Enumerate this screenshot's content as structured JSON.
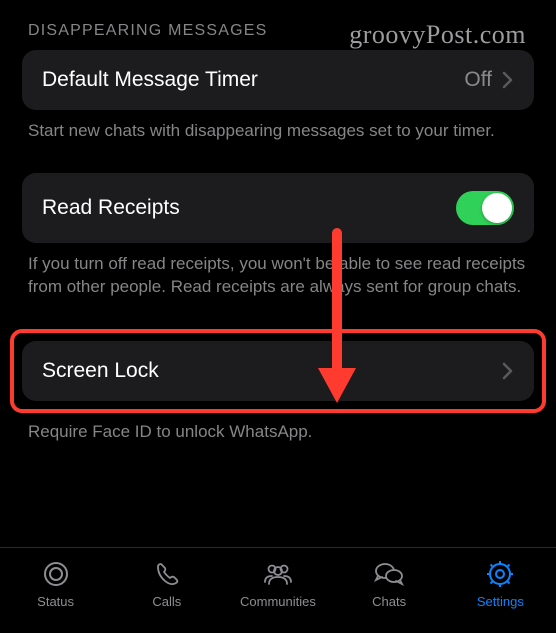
{
  "watermark": "groovyPost.com",
  "disappearing": {
    "header": "DISAPPEARING MESSAGES",
    "timer_label": "Default Message Timer",
    "timer_value": "Off",
    "footer": "Start new chats with disappearing messages set to your timer."
  },
  "read_receipts": {
    "label": "Read Receipts",
    "enabled": true,
    "footer": "If you turn off read receipts, you won't be able to see read receipts from other people. Read receipts are always sent for group chats."
  },
  "screen_lock": {
    "label": "Screen Lock",
    "footer": "Require Face ID to unlock WhatsApp."
  },
  "tabs": {
    "status": "Status",
    "calls": "Calls",
    "communities": "Communities",
    "chats": "Chats",
    "settings": "Settings"
  }
}
